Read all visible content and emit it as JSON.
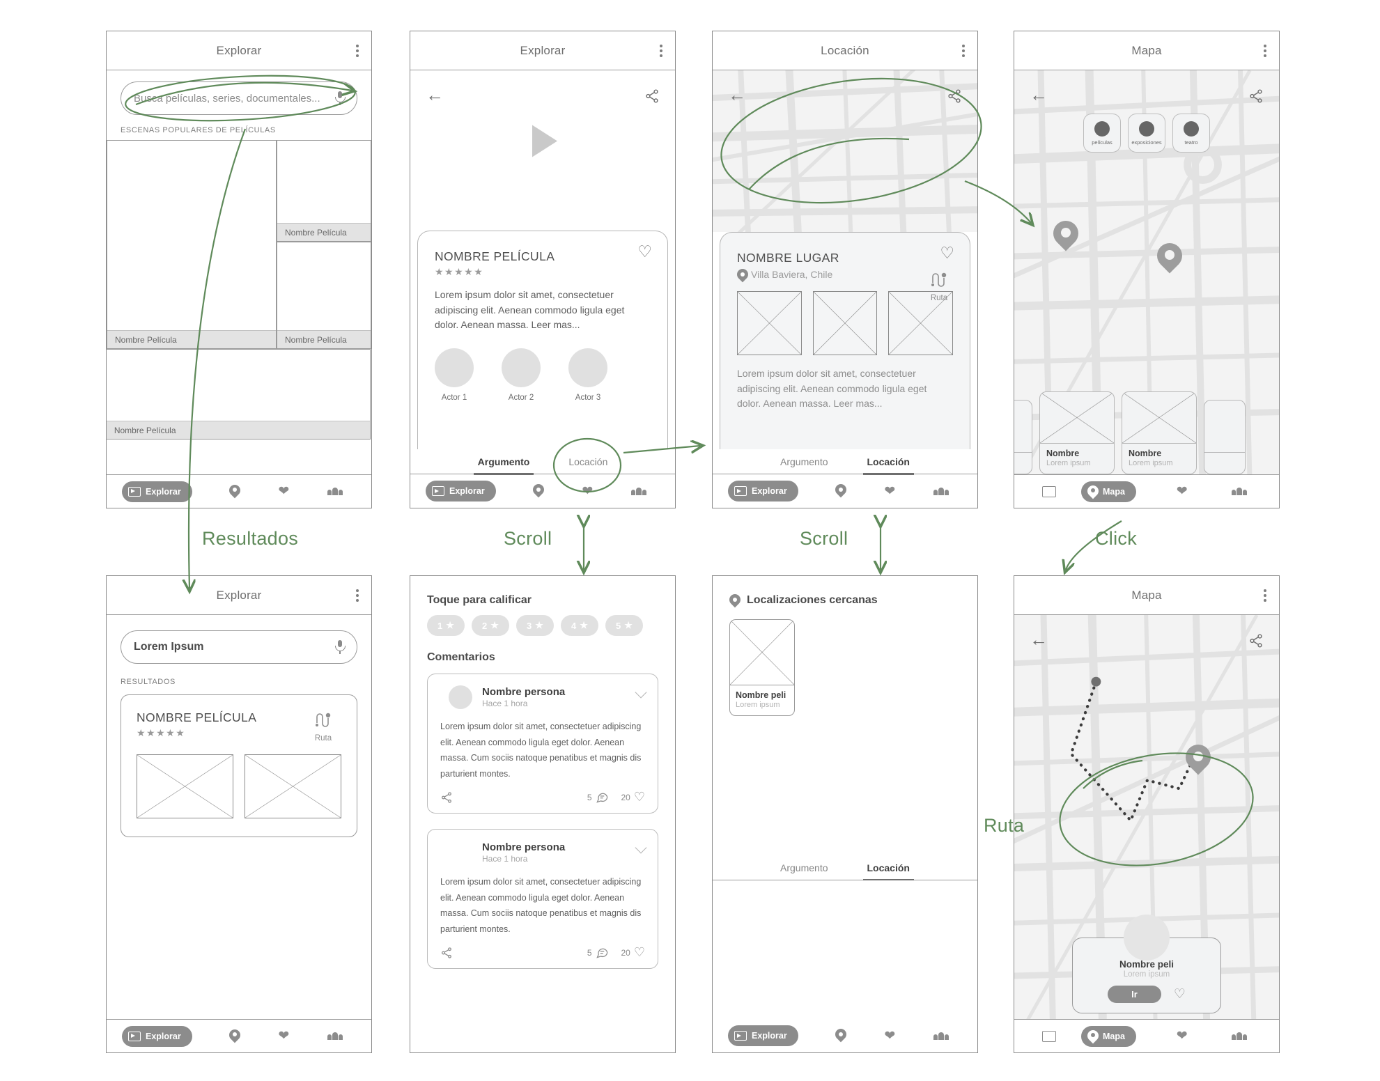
{
  "screens": {
    "explore": {
      "title": "Explorar",
      "search_placeholder": "Busca películas, series, documentales...",
      "section_label": "ESCENAS POPULARES DE PELÍCULAS",
      "tiles": [
        {
          "caption": "Nombre Película"
        },
        {
          "caption": "Nombre Película"
        },
        {
          "caption": "Nombre Película"
        },
        {
          "caption": "Nombre Película"
        }
      ],
      "nav": {
        "explore": "Explorar"
      }
    },
    "movie_detail": {
      "title": "Explorar",
      "movie_title": "NOMBRE PELÍCULA",
      "stars": "★★★★★",
      "description": "Lorem ipsum dolor sit amet, consectetuer adipiscing elit. Aenean commodo ligula eget dolor. Aenean massa. Leer mas...",
      "actors": [
        {
          "name": "Actor 1"
        },
        {
          "name": "Actor 2"
        },
        {
          "name": "Actor 3"
        }
      ],
      "tabs": [
        {
          "label": "Argumento",
          "active": true
        },
        {
          "label": "Locación",
          "active": false
        }
      ],
      "nav": {
        "explore": "Explorar"
      }
    },
    "location": {
      "title": "Locación",
      "place_title": "NOMBRE LUGAR",
      "place_subtitle": "Villa Baviera, Chile",
      "route_label": "Ruta",
      "description": "Lorem ipsum dolor sit amet, consectetuer adipiscing elit. Aenean commodo ligula eget dolor. Aenean massa. Leer mas...",
      "tabs": [
        {
          "label": "Argumento",
          "active": false
        },
        {
          "label": "Locación",
          "active": true
        }
      ],
      "nav": {
        "explore": "Explorar"
      }
    },
    "map": {
      "title": "Mapa",
      "filters": [
        {
          "label": "películas"
        },
        {
          "label": "exposiciones"
        },
        {
          "label": "teatro"
        }
      ],
      "cards": [
        {
          "name": "Nombre",
          "subtitle": "Lorem ipsum"
        },
        {
          "name": "Nombre",
          "subtitle": "Lorem ipsum"
        }
      ],
      "nav": {
        "map": "Mapa"
      }
    },
    "results": {
      "title": "Explorar",
      "search_value": "Lorem Ipsum",
      "section_label": "RESULTADOS",
      "result_title": "NOMBRE PELÍCULA",
      "stars": "★★★★★",
      "route_label": "Ruta",
      "nav": {
        "explore": "Explorar"
      }
    },
    "comments": {
      "rate_heading": "Toque para calificar",
      "rating_chips": [
        {
          "label": "1"
        },
        {
          "label": "2"
        },
        {
          "label": "3"
        },
        {
          "label": "4"
        },
        {
          "label": "5"
        }
      ],
      "comments_heading": "Comentarios",
      "comments": [
        {
          "name": "Nombre persona",
          "time": "Hace 1 hora",
          "text": "Lorem ipsum dolor sit amet, consectetuer adipiscing elit. Aenean commodo ligula eget dolor. Aenean massa. Cum sociis natoque penatibus et magnis dis parturient montes.",
          "comment_count": "5",
          "like_count": "20"
        },
        {
          "name": "Nombre persona",
          "time": "Hace 1 hora",
          "text": "Lorem ipsum dolor sit amet, consectetuer adipiscing elit. Aenean commodo ligula eget dolor. Aenean massa. Cum sociis natoque penatibus et magnis dis parturient montes.",
          "comment_count": "5",
          "like_count": "20"
        }
      ]
    },
    "nearby": {
      "heading": "Localizaciones cercanas",
      "card": {
        "name": "Nombre peli",
        "subtitle": "Lorem ipsum"
      },
      "tabs": [
        {
          "label": "Argumento",
          "active": false
        },
        {
          "label": "Locación",
          "active": true
        }
      ],
      "nav": {
        "explore": "Explorar"
      }
    },
    "route_map": {
      "title": "Mapa",
      "card": {
        "name": "Nombre peli",
        "subtitle": "Lorem ipsum",
        "button": "Ir"
      },
      "nav": {
        "map": "Mapa"
      }
    }
  },
  "annotations": [
    {
      "label": "Resultados"
    },
    {
      "label": "Scroll"
    },
    {
      "label": "Scroll"
    },
    {
      "label": "Click"
    },
    {
      "label": "Ruta"
    }
  ],
  "colors": {
    "annotation_green": "#5f8a5a",
    "wire_gray": "#8a8a8a",
    "fill_gray": "#8c8c8c",
    "map_bg": "#f3f3f3",
    "map_road": "#e2e2e2"
  }
}
